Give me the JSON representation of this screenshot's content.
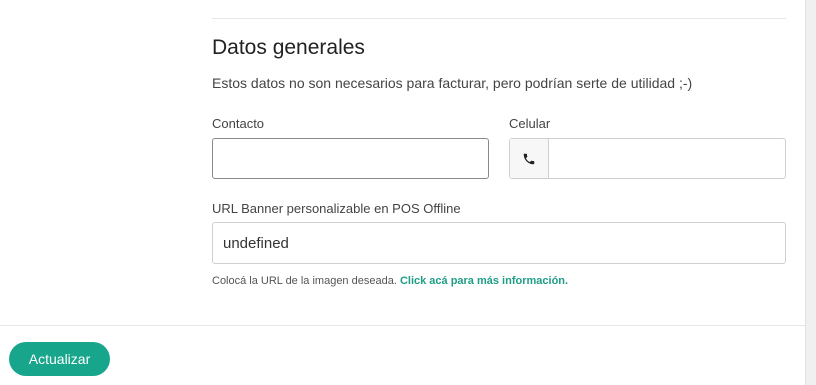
{
  "section": {
    "title": "Datos generales",
    "description": "Estos datos no son necesarios para facturar, pero podrían serte de utilidad ;-)"
  },
  "contact": {
    "label": "Contacto",
    "value": ""
  },
  "phone": {
    "label": "Celular",
    "value": "",
    "icon": "phone-icon"
  },
  "banner_url": {
    "label": "URL Banner personalizable en POS Offline",
    "value": "undefined",
    "help_text": "Colocá la URL de la imagen deseada.",
    "help_link": "Click acá para más información."
  },
  "actions": {
    "update_label": "Actualizar"
  },
  "colors": {
    "accent": "#17a58c",
    "link": "#1f9d86"
  }
}
